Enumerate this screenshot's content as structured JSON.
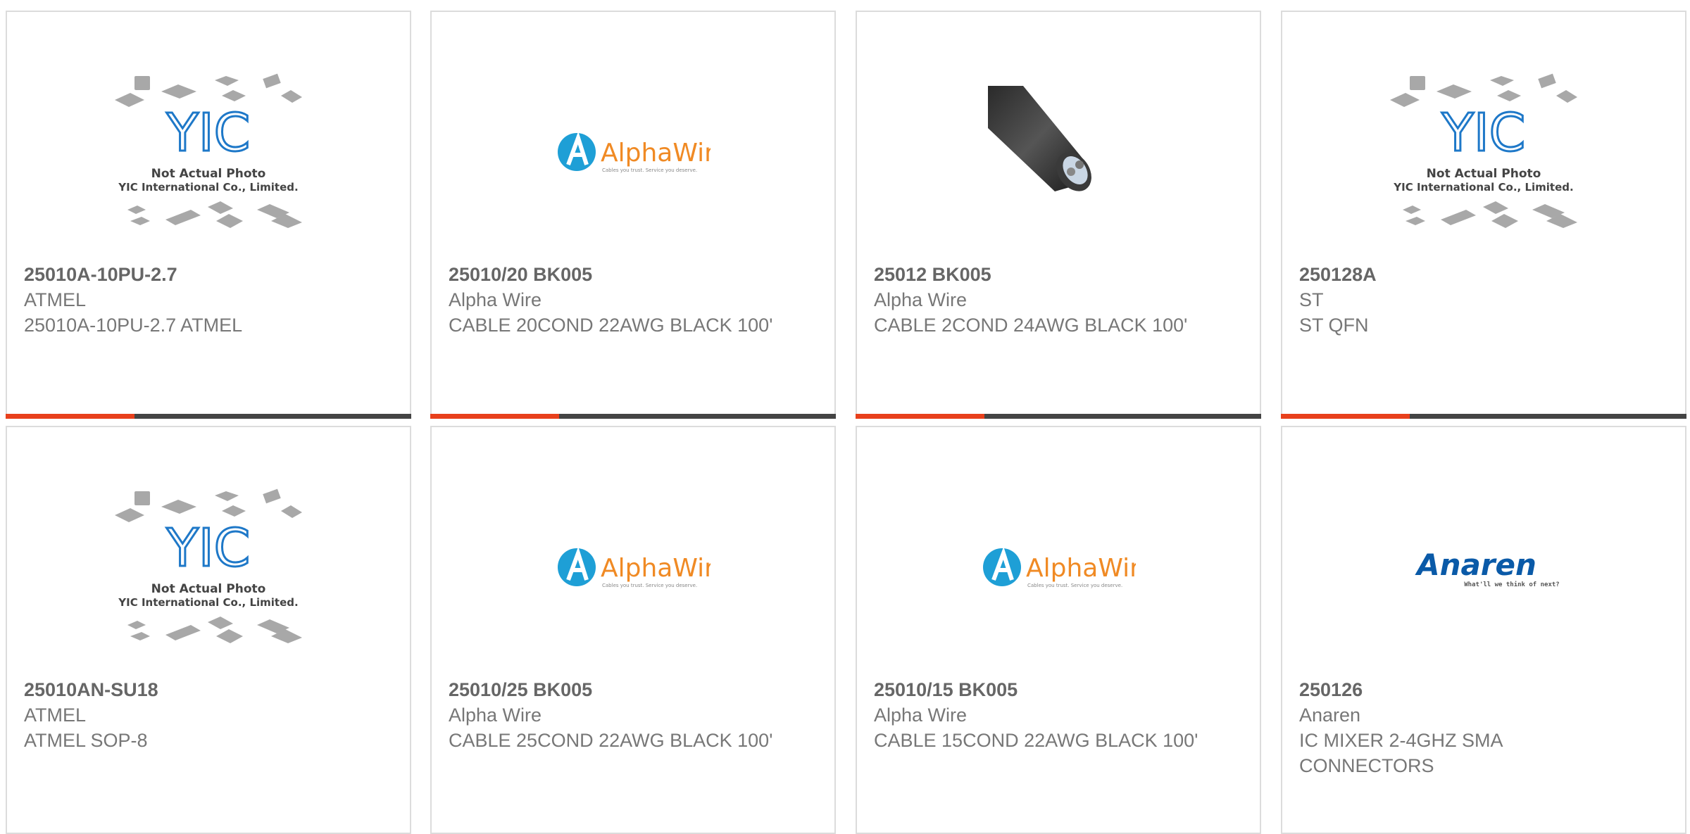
{
  "colors": {
    "accent": "#e8401c",
    "bar": "#444444",
    "border": "#dcdcdc",
    "text": "#777777",
    "alphawire_blue": "#1e9fd6",
    "alphawire_orange": "#f08a24",
    "anaren_blue": "#0a5aa8",
    "yic_blue": "#1e78c8"
  },
  "products": [
    {
      "part": "25010A-10PU-2.7",
      "brand": "ATMEL",
      "desc": "25010A-10PU-2.7 ATMEL",
      "image": "yic-placeholder"
    },
    {
      "part": "25010/20 BK005",
      "brand": "Alpha Wire",
      "desc": "CABLE 20COND 22AWG BLACK 100'",
      "image": "alphawire-logo"
    },
    {
      "part": "25012 BK005",
      "brand": "Alpha Wire",
      "desc": "CABLE 2COND 24AWG BLACK 100'",
      "image": "cable-photo"
    },
    {
      "part": "250128A",
      "brand": "ST",
      "desc": "ST QFN",
      "image": "yic-placeholder"
    },
    {
      "part": "25010AN-SU18",
      "brand": "ATMEL",
      "desc": "ATMEL SOP-8",
      "image": "yic-placeholder"
    },
    {
      "part": "25010/25 BK005",
      "brand": "Alpha Wire",
      "desc": "CABLE 25COND 22AWG BLACK 100'",
      "image": "alphawire-logo"
    },
    {
      "part": "25010/15 BK005",
      "brand": "Alpha Wire",
      "desc": "CABLE 15COND 22AWG BLACK 100'",
      "image": "alphawire-logo"
    },
    {
      "part": "250126",
      "brand": "Anaren",
      "desc": "IC MIXER 2-4GHZ SMA CONNECTORS",
      "image": "anaren-logo"
    }
  ],
  "logos": {
    "yic": {
      "mark": "YIC",
      "line1": "Not Actual Photo",
      "line2": "YIC International Co., Limited."
    },
    "alphawire": {
      "name": "AlphaWire",
      "tagline": "Cables you trust. Service you deserve."
    },
    "anaren": {
      "name": "Anaren",
      "tagline": "What'll we think of next?"
    }
  }
}
